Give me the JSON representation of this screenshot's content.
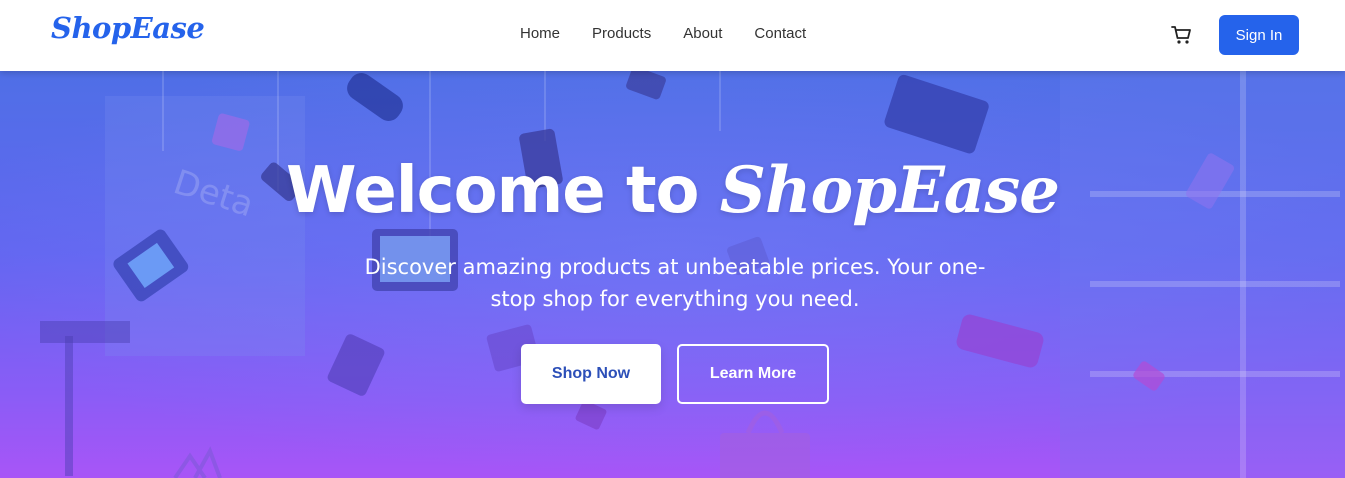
{
  "brand": {
    "name": "ShopEase",
    "color": "#2563eb"
  },
  "nav": {
    "links": [
      {
        "label": "Home"
      },
      {
        "label": "Products"
      },
      {
        "label": "About"
      },
      {
        "label": "Contact"
      }
    ],
    "cart_icon": "shopping-cart-icon",
    "signin_label": "Sign In"
  },
  "hero": {
    "title_prefix": "Welcome to",
    "title_brand": "ShopEase",
    "subtitle": "Discover amazing products at unbeatable prices. Your one-stop shop for everything you need.",
    "primary_cta": "Shop Now",
    "secondary_cta": "Learn More",
    "gradient_colors": [
      "#4f6fe6",
      "#6366f1",
      "#8b5cf6",
      "#a855f7"
    ]
  }
}
